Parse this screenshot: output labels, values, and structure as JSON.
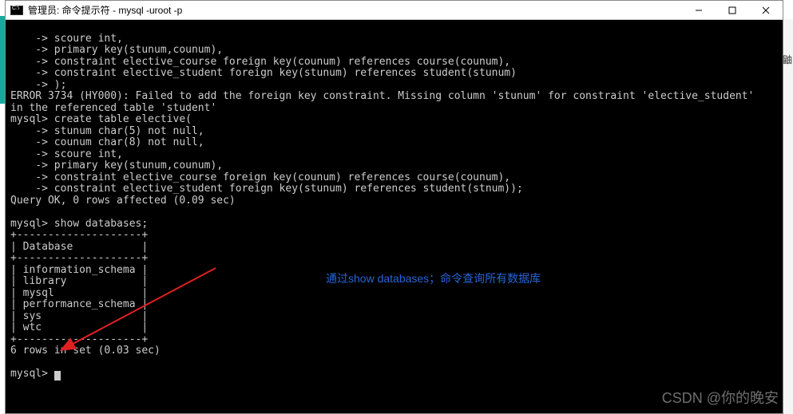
{
  "titlebar": {
    "text": "管理员: 命令提示符 - mysql  -uroot -p"
  },
  "terminal": {
    "l1": "    -> scoure int,",
    "l2": "    -> primary key(stunum,counum),",
    "l3": "    -> constraint elective_course foreign key(counum) references course(counum),",
    "l4": "    -> constraint elective_student foreign key(stunum) references student(stunum)",
    "l5": "    -> );",
    "l6": "ERROR 3734 (HY000): Failed to add the foreign key constraint. Missing column 'stunum' for constraint 'elective_student'",
    "l7": "in the referenced table 'student'",
    "l8": "mysql> create table elective(",
    "l9": "    -> stunum char(5) not null,",
    "l10": "    -> counum char(8) not null,",
    "l11": "    -> scoure int,",
    "l12": "    -> primary key(stunum,counum),",
    "l13": "    -> constraint elective_course foreign key(counum) references course(counum),",
    "l14": "    -> constraint elective_student foreign key(stunum) references student(stnum));",
    "l15": "Query OK, 0 rows affected (0.09 sec)",
    "l16": "",
    "l17": "mysql> show databases;",
    "l18": "+--------------------+",
    "l19": "| Database           |",
    "l20": "+--------------------+",
    "l21": "| information_schema |",
    "l22": "| library            |",
    "l23": "| mysql              |",
    "l24": "| performance_schema |",
    "l25": "| sys                |",
    "l26": "| wtc                |",
    "l27": "+--------------------+",
    "l28": "6 rows in set (0.03 sec)",
    "l29": "",
    "l30": "mysql> "
  },
  "annotation": "通过show databases；命令查询所有数据库",
  "watermark": "CSDN @你的晚安",
  "right_char": "鼬",
  "chart_data": {
    "type": "table",
    "title": "Database",
    "categories": [
      "Database"
    ],
    "rows": [
      "information_schema",
      "library",
      "mysql",
      "performance_schema",
      "sys",
      "wtc"
    ]
  }
}
